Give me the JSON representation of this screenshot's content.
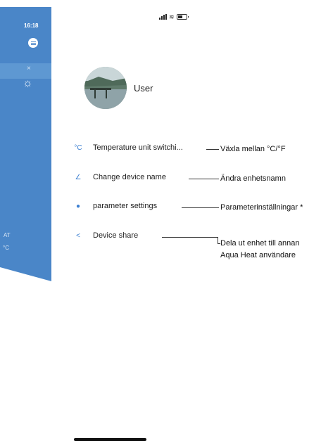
{
  "background_app": {
    "time": "16:18",
    "close_symbol": "×",
    "sun_symbol": "☼",
    "label_1": "AT",
    "label_2": "°C"
  },
  "status_bar": {
    "icons": [
      "signal-icon",
      "wifi-icon",
      "battery-icon"
    ]
  },
  "profile": {
    "name": "User"
  },
  "menu": [
    {
      "icon": "°C",
      "label": "Temperature unit switchi..."
    },
    {
      "icon": "∠",
      "label": "Change device name"
    },
    {
      "icon": "●",
      "label": "parameter settings"
    },
    {
      "icon": "<",
      "label": "Device share"
    }
  ],
  "annotations": [
    {
      "text": "Växla mellan °C/°F"
    },
    {
      "text": "Ändra enhetsnamn"
    },
    {
      "text": "Parameterinställningar *"
    },
    {
      "text": "Dela ut enhet till annan"
    },
    {
      "text": "Aqua Heat användare"
    }
  ],
  "colors": {
    "accent": "#3b7fd1",
    "panel_blue": "#4a86c8"
  }
}
